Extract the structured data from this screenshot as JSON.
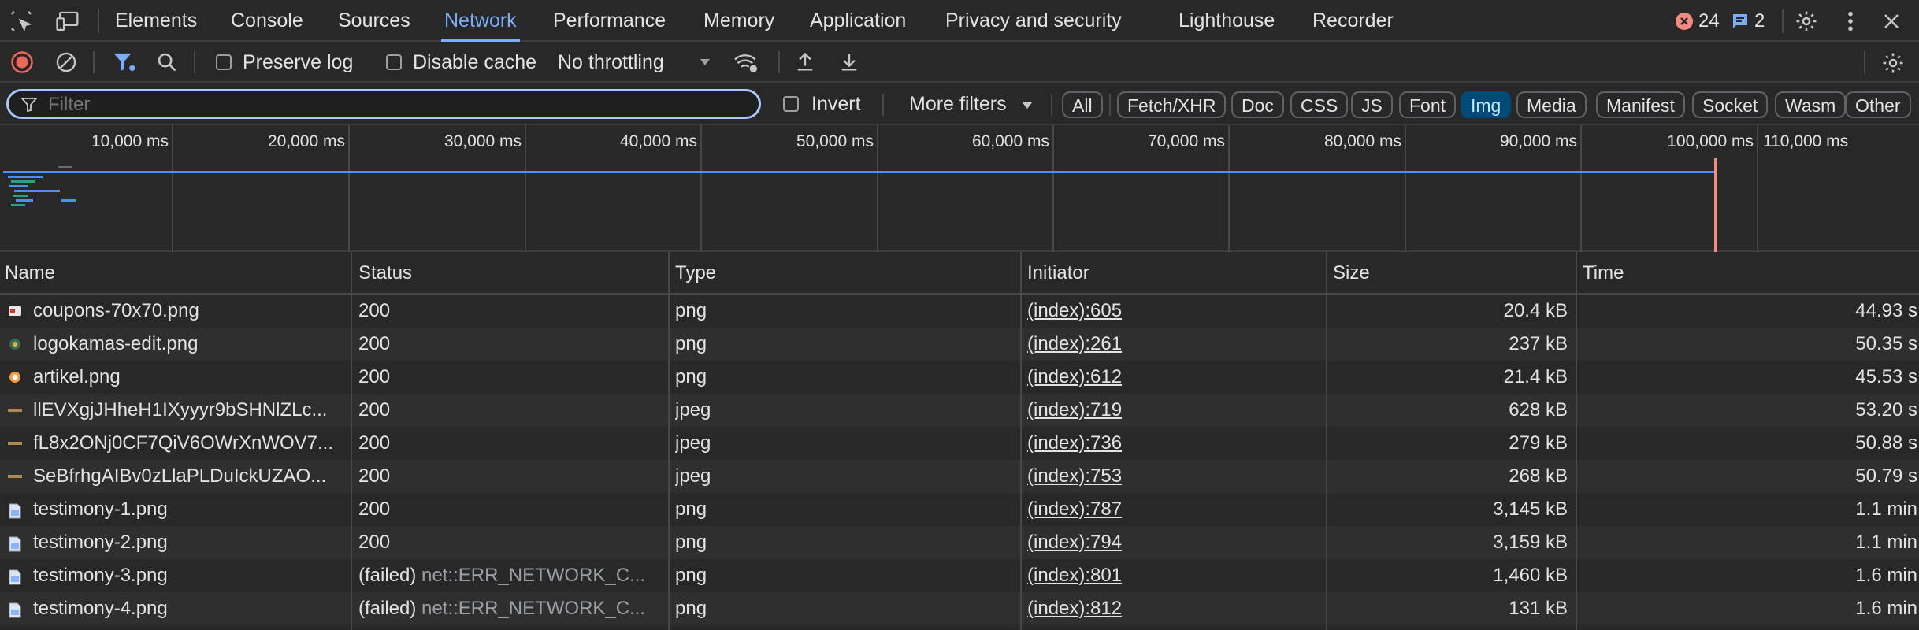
{
  "tabs": [
    {
      "label": "Elements",
      "active": false
    },
    {
      "label": "Console",
      "active": false
    },
    {
      "label": "Sources",
      "active": false
    },
    {
      "label": "Network",
      "active": true
    },
    {
      "label": "Performance",
      "active": false
    },
    {
      "label": "Memory",
      "active": false
    },
    {
      "label": "Application",
      "active": false
    },
    {
      "label": "Privacy and security",
      "active": false
    },
    {
      "label": "Lighthouse",
      "active": false
    },
    {
      "label": "Recorder",
      "active": false
    }
  ],
  "badges": {
    "errors": "24",
    "messages": "2"
  },
  "toolbar": {
    "preserve_log": "Preserve log",
    "disable_cache": "Disable cache",
    "throttling": "No throttling"
  },
  "filter": {
    "placeholder": "Filter",
    "invert": "Invert",
    "more_filters": "More filters",
    "chips": [
      {
        "label": "All",
        "active": false
      },
      {
        "label": "Fetch/XHR",
        "active": false
      },
      {
        "label": "Doc",
        "active": false
      },
      {
        "label": "CSS",
        "active": false
      },
      {
        "label": "JS",
        "active": false
      },
      {
        "label": "Font",
        "active": false
      },
      {
        "label": "Img",
        "active": true
      },
      {
        "label": "Media",
        "active": false
      },
      {
        "label": "Manifest",
        "active": false
      },
      {
        "label": "Socket",
        "active": false
      },
      {
        "label": "Wasm",
        "active": false
      },
      {
        "label": "Other",
        "active": false
      }
    ]
  },
  "overview": {
    "ticks": [
      "10,000 ms",
      "20,000 ms",
      "30,000 ms",
      "40,000 ms",
      "50,000 ms",
      "60,000 ms",
      "70,000 ms",
      "80,000 ms",
      "90,000 ms",
      "100,000 ms",
      "110,000 ms"
    ]
  },
  "table": {
    "columns": [
      "Name",
      "Status",
      "Type",
      "Initiator",
      "Size",
      "Time"
    ],
    "rows": [
      {
        "name": "coupons-70x70.png",
        "status": "200",
        "status_detail": "",
        "type": "png",
        "initiator": "(index):605",
        "size": "20.4 kB",
        "time": "44.93 s",
        "icon": "coupon-thumb-icon"
      },
      {
        "name": "logokamas-edit.png",
        "status": "200",
        "status_detail": "",
        "type": "png",
        "initiator": "(index):261",
        "size": "237 kB",
        "time": "50.35 s",
        "icon": "logo-thumb-icon"
      },
      {
        "name": "artikel.png",
        "status": "200",
        "status_detail": "",
        "type": "png",
        "initiator": "(index):612",
        "size": "21.4 kB",
        "time": "45.53 s",
        "icon": "article-thumb-icon"
      },
      {
        "name": "llEVXgjJHheH1IXyyyr9bSHNlZLc...",
        "status": "200",
        "status_detail": "",
        "type": "jpeg",
        "initiator": "(index):719",
        "size": "628 kB",
        "time": "53.20 s",
        "icon": "banner-thumb-icon"
      },
      {
        "name": "fL8x2ONj0CF7QiV6OWrXnWOV7...",
        "status": "200",
        "status_detail": "",
        "type": "jpeg",
        "initiator": "(index):736",
        "size": "279 kB",
        "time": "50.88 s",
        "icon": "banner-thumb-icon"
      },
      {
        "name": "SeBfrhgAIBv0zLlaPLDuIckUZAO...",
        "status": "200",
        "status_detail": "",
        "type": "jpeg",
        "initiator": "(index):753",
        "size": "268 kB",
        "time": "50.79 s",
        "icon": "banner-thumb-icon"
      },
      {
        "name": "testimony-1.png",
        "status": "200",
        "status_detail": "",
        "type": "png",
        "initiator": "(index):787",
        "size": "3,145 kB",
        "time": "1.1 min",
        "icon": "image-file-icon"
      },
      {
        "name": "testimony-2.png",
        "status": "200",
        "status_detail": "",
        "type": "png",
        "initiator": "(index):794",
        "size": "3,159 kB",
        "time": "1.1 min",
        "icon": "image-file-icon"
      },
      {
        "name": "testimony-3.png",
        "status": "(failed)",
        "status_detail": "net::ERR_NETWORK_C...",
        "type": "png",
        "initiator": "(index):801",
        "size": "1,460 kB",
        "time": "1.6 min",
        "icon": "image-file-icon"
      },
      {
        "name": "testimony-4.png",
        "status": "(failed)",
        "status_detail": "net::ERR_NETWORK_C...",
        "type": "png",
        "initiator": "(index):812",
        "size": "131 kB",
        "time": "1.6 min",
        "icon": "image-file-icon"
      }
    ]
  },
  "colors": {
    "accent": "#7cacf8",
    "error": "#f28b82",
    "record": "#ee675c",
    "timeline_bar": "#4c8df6",
    "marker": "#f28b82"
  }
}
